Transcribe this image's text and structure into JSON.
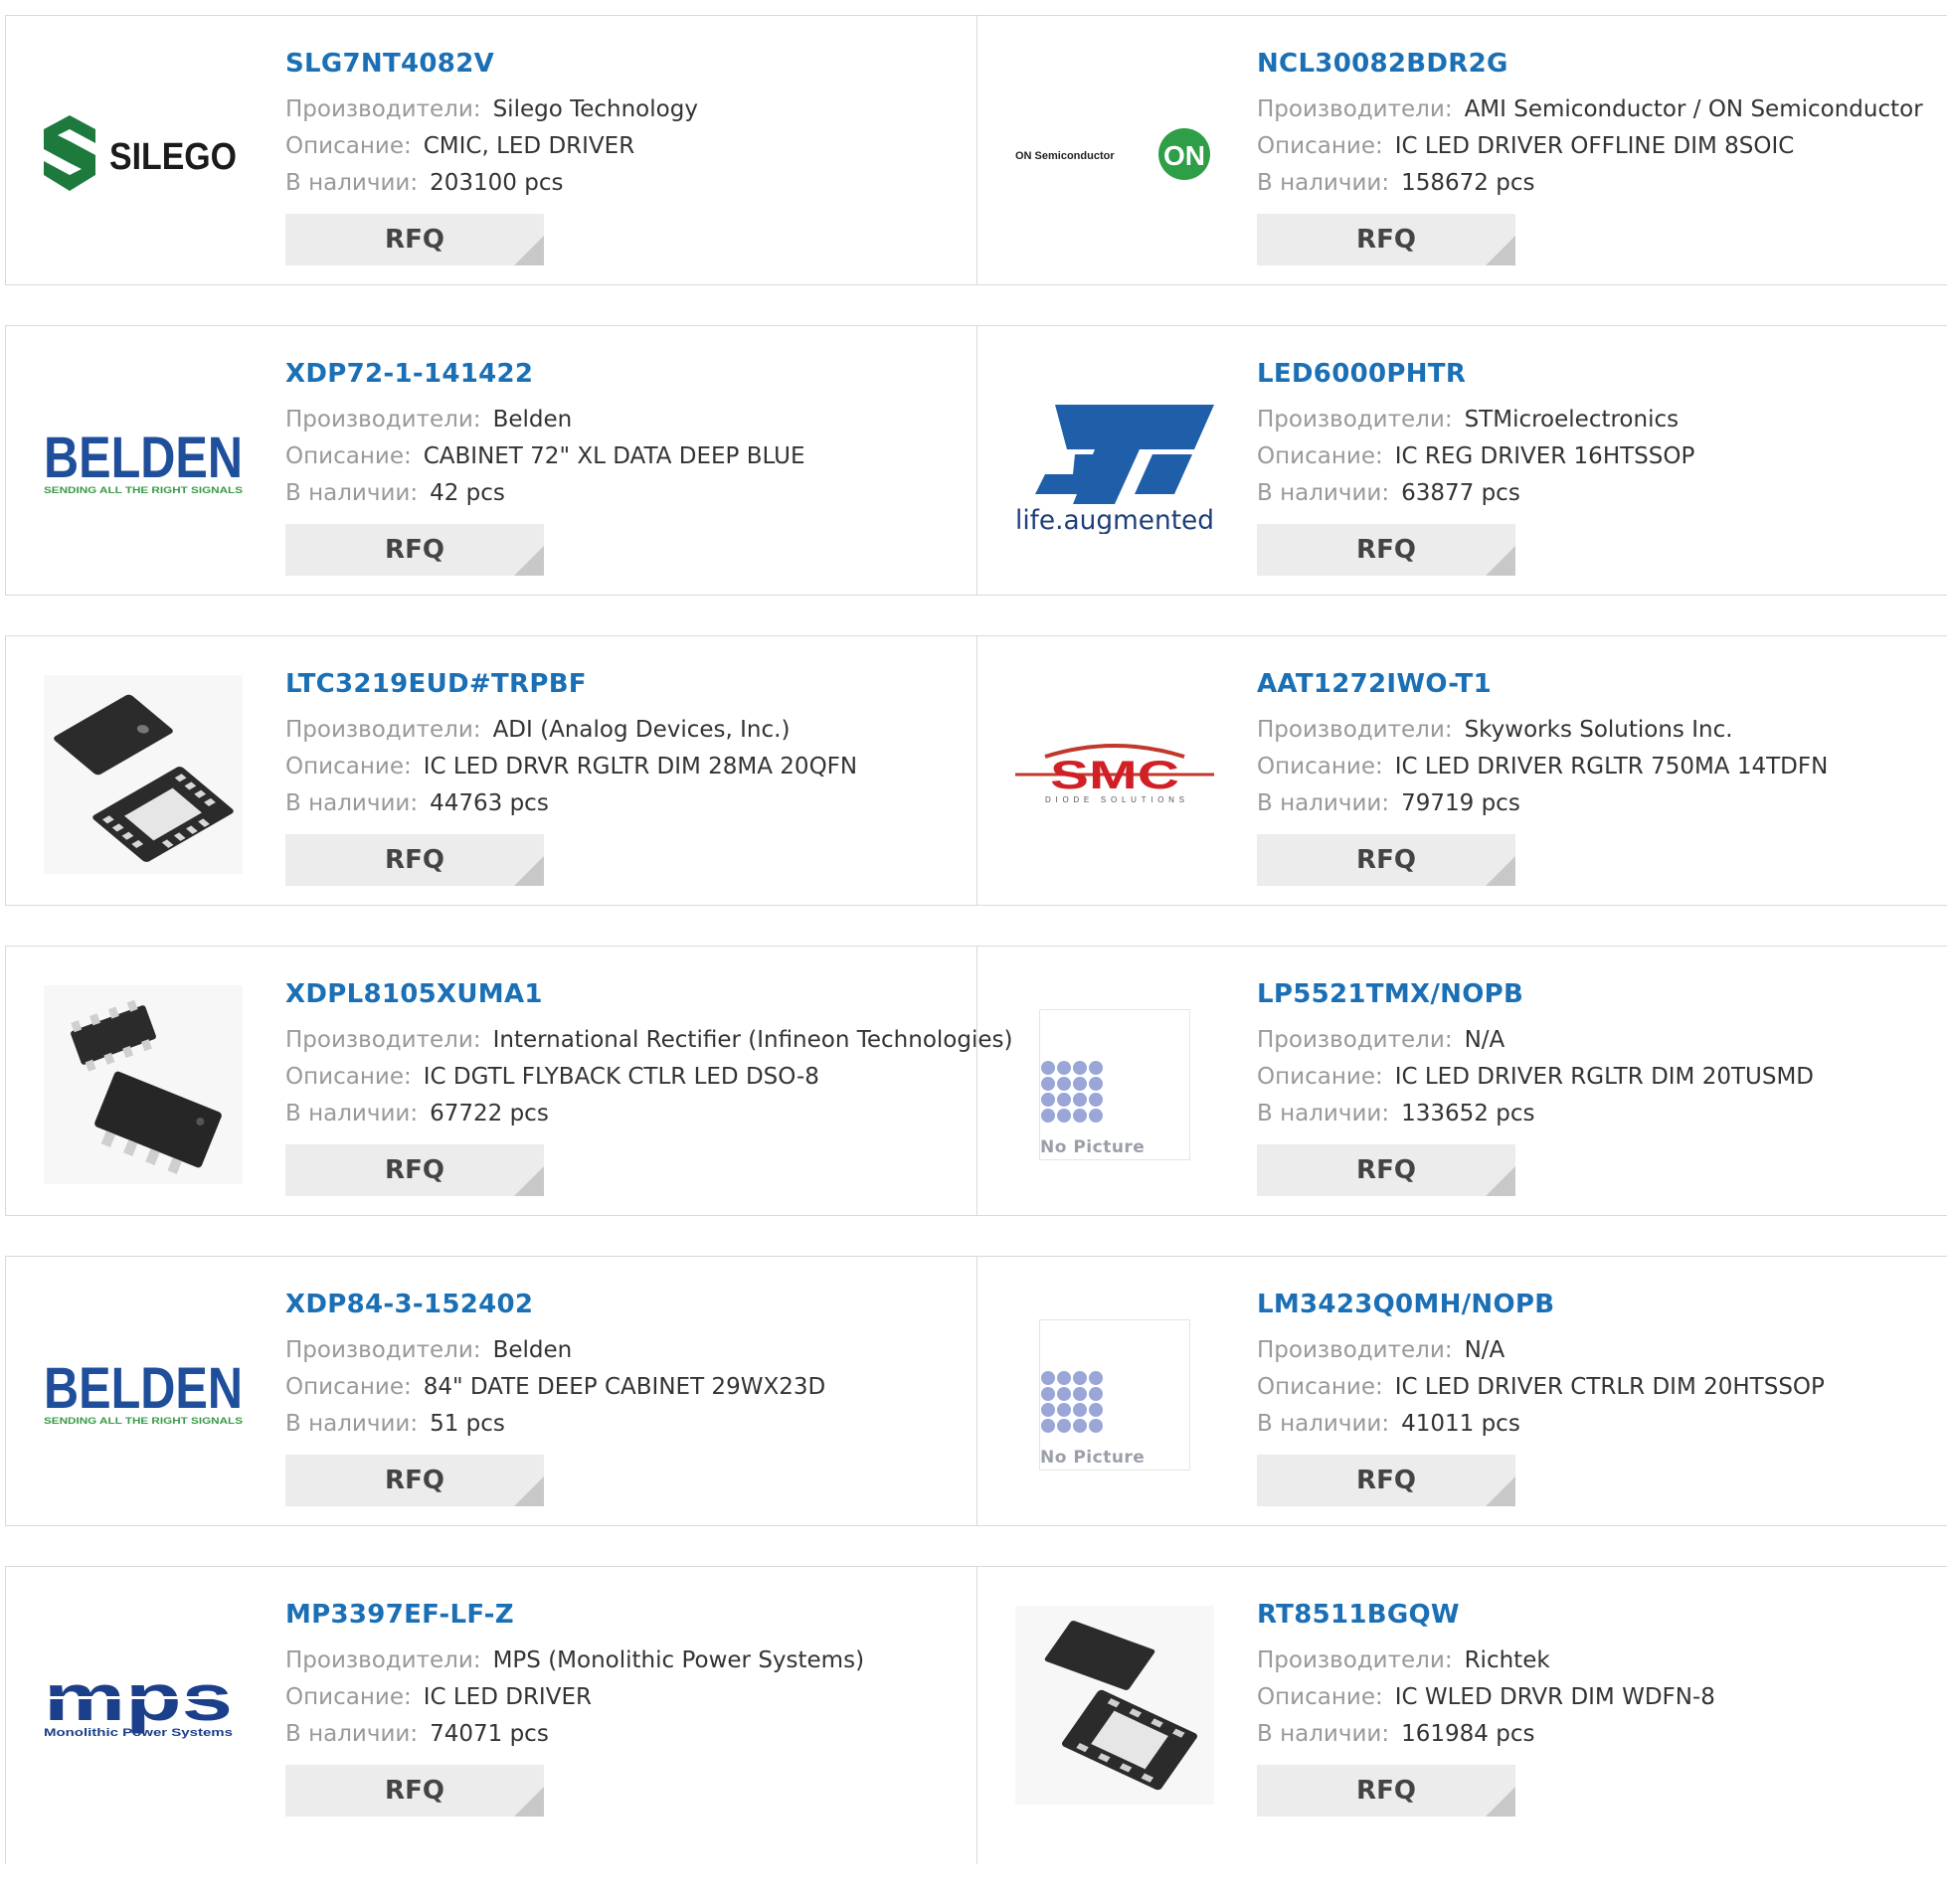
{
  "labels": {
    "manufacturer": "Производители:",
    "description": "Описание:",
    "stock": "В наличии:",
    "rfq": "RFQ"
  },
  "logos": {
    "silego": "SILEGO",
    "on_text": "ON Semiconductor",
    "on_badge": "ON",
    "belden": "BELDEN",
    "belden_tag": "SENDING ALL THE RIGHT SIGNALS",
    "st_tag": "life.augmented",
    "smc": "SMC",
    "smc_tag": "DIODE SOLUTIONS",
    "mps": "mps",
    "mps_tag": "Monolithic Power Systems",
    "no_picture": "No Picture"
  },
  "colors": {
    "link": "#1a6fb5",
    "label": "#999999",
    "button_bg": "#ececec"
  },
  "products": [
    {
      "part": "SLG7NT4082V",
      "manufacturer": "Silego Technology",
      "description": "CMIC, LED DRIVER",
      "stock": "203100 pcs",
      "image": "silego-logo"
    },
    {
      "part": "NCL30082BDR2G",
      "manufacturer": "AMI Semiconductor / ON Semiconductor",
      "description": "IC LED DRIVER OFFLINE DIM 8SOIC",
      "stock": "158672 pcs",
      "image": "on-semiconductor-logo"
    },
    {
      "part": "XDP72-1-141422",
      "manufacturer": "Belden",
      "description": "CABINET 72\" XL DATA DEEP BLUE",
      "stock": "42 pcs",
      "image": "belden-logo"
    },
    {
      "part": "LED6000PHTR",
      "manufacturer": "STMicroelectronics",
      "description": "IC REG DRIVER 16HTSSOP",
      "stock": "63877 pcs",
      "image": "st-logo"
    },
    {
      "part": "LTC3219EUD#TRPBF",
      "manufacturer": "ADI (Analog Devices, Inc.)",
      "description": "IC LED DRVR RGLTR DIM 28MA 20QFN",
      "stock": "44763 pcs",
      "image": "qfn-chip"
    },
    {
      "part": "AAT1272IWO-T1",
      "manufacturer": "Skyworks Solutions Inc.",
      "description": "IC LED DRIVER RGLTR 750MA 14TDFN",
      "stock": "79719 pcs",
      "image": "smc-logo"
    },
    {
      "part": "XDPL8105XUMA1",
      "manufacturer": "International Rectifier (Infineon Technologies)",
      "description": "IC DGTL FLYBACK CTLR LED DSO-8",
      "stock": "67722 pcs",
      "image": "soic-chip"
    },
    {
      "part": "LP5521TMX/NOPB",
      "manufacturer": "N/A",
      "description": "IC LED DRIVER RGLTR DIM 20TUSMD",
      "stock": "133652 pcs",
      "image": "no-picture"
    },
    {
      "part": "XDP84-3-152402",
      "manufacturer": "Belden",
      "description": "84\" DATE DEEP CABINET 29WX23D",
      "stock": "51 pcs",
      "image": "belden-logo"
    },
    {
      "part": "LM3423Q0MH/NOPB",
      "manufacturer": "N/A",
      "description": "IC LED DRIVER CTRLR DIM 20HTSSOP",
      "stock": "41011 pcs",
      "image": "no-picture"
    },
    {
      "part": "MP3397EF-LF-Z",
      "manufacturer": "MPS (Monolithic Power Systems)",
      "description": "IC LED DRIVER",
      "stock": "74071 pcs",
      "image": "mps-logo"
    },
    {
      "part": "RT8511BGQW",
      "manufacturer": "Richtek",
      "description": "IC WLED DRVR DIM WDFN-8",
      "stock": "161984 pcs",
      "image": "dfn-chip"
    }
  ]
}
